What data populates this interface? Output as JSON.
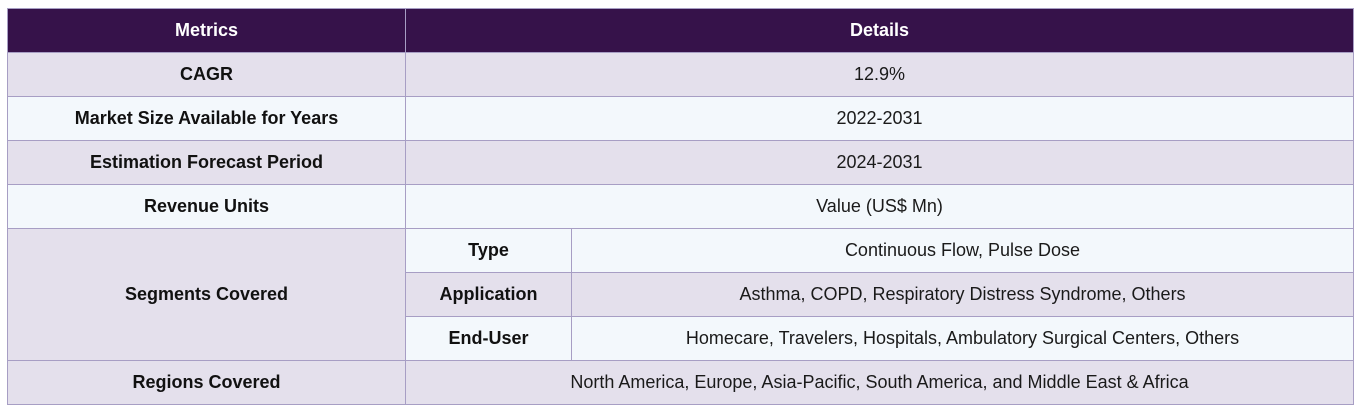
{
  "table": {
    "headers": {
      "metrics": "Metrics",
      "details": "Details"
    },
    "rows": [
      {
        "metric": "CAGR",
        "value": "12.9%"
      },
      {
        "metric": "Market Size Available for Years",
        "value": "2022-2031"
      },
      {
        "metric": "Estimation Forecast Period",
        "value": "2024-2031"
      },
      {
        "metric": "Revenue Units",
        "value": "Value (US$ Mn)"
      }
    ],
    "segments": {
      "metric": "Segments Covered",
      "items": [
        {
          "label": "Type",
          "value": "Continuous Flow, Pulse Dose"
        },
        {
          "label": "Application",
          "value": "Asthma, COPD, Respiratory Distress Syndrome, Others"
        },
        {
          "label": "End-User",
          "value": "Homecare, Travelers, Hospitals, Ambulatory Surgical Centers, Others"
        }
      ]
    },
    "regions": {
      "metric": "Regions Covered",
      "value": "North America, Europe, Asia-Pacific, South America, and Middle East & Africa"
    }
  },
  "colors": {
    "header_bg": "#36124a",
    "row_shade": "#e4e0ec",
    "row_light": "#f3f8fc",
    "border": "#a79ec4"
  }
}
